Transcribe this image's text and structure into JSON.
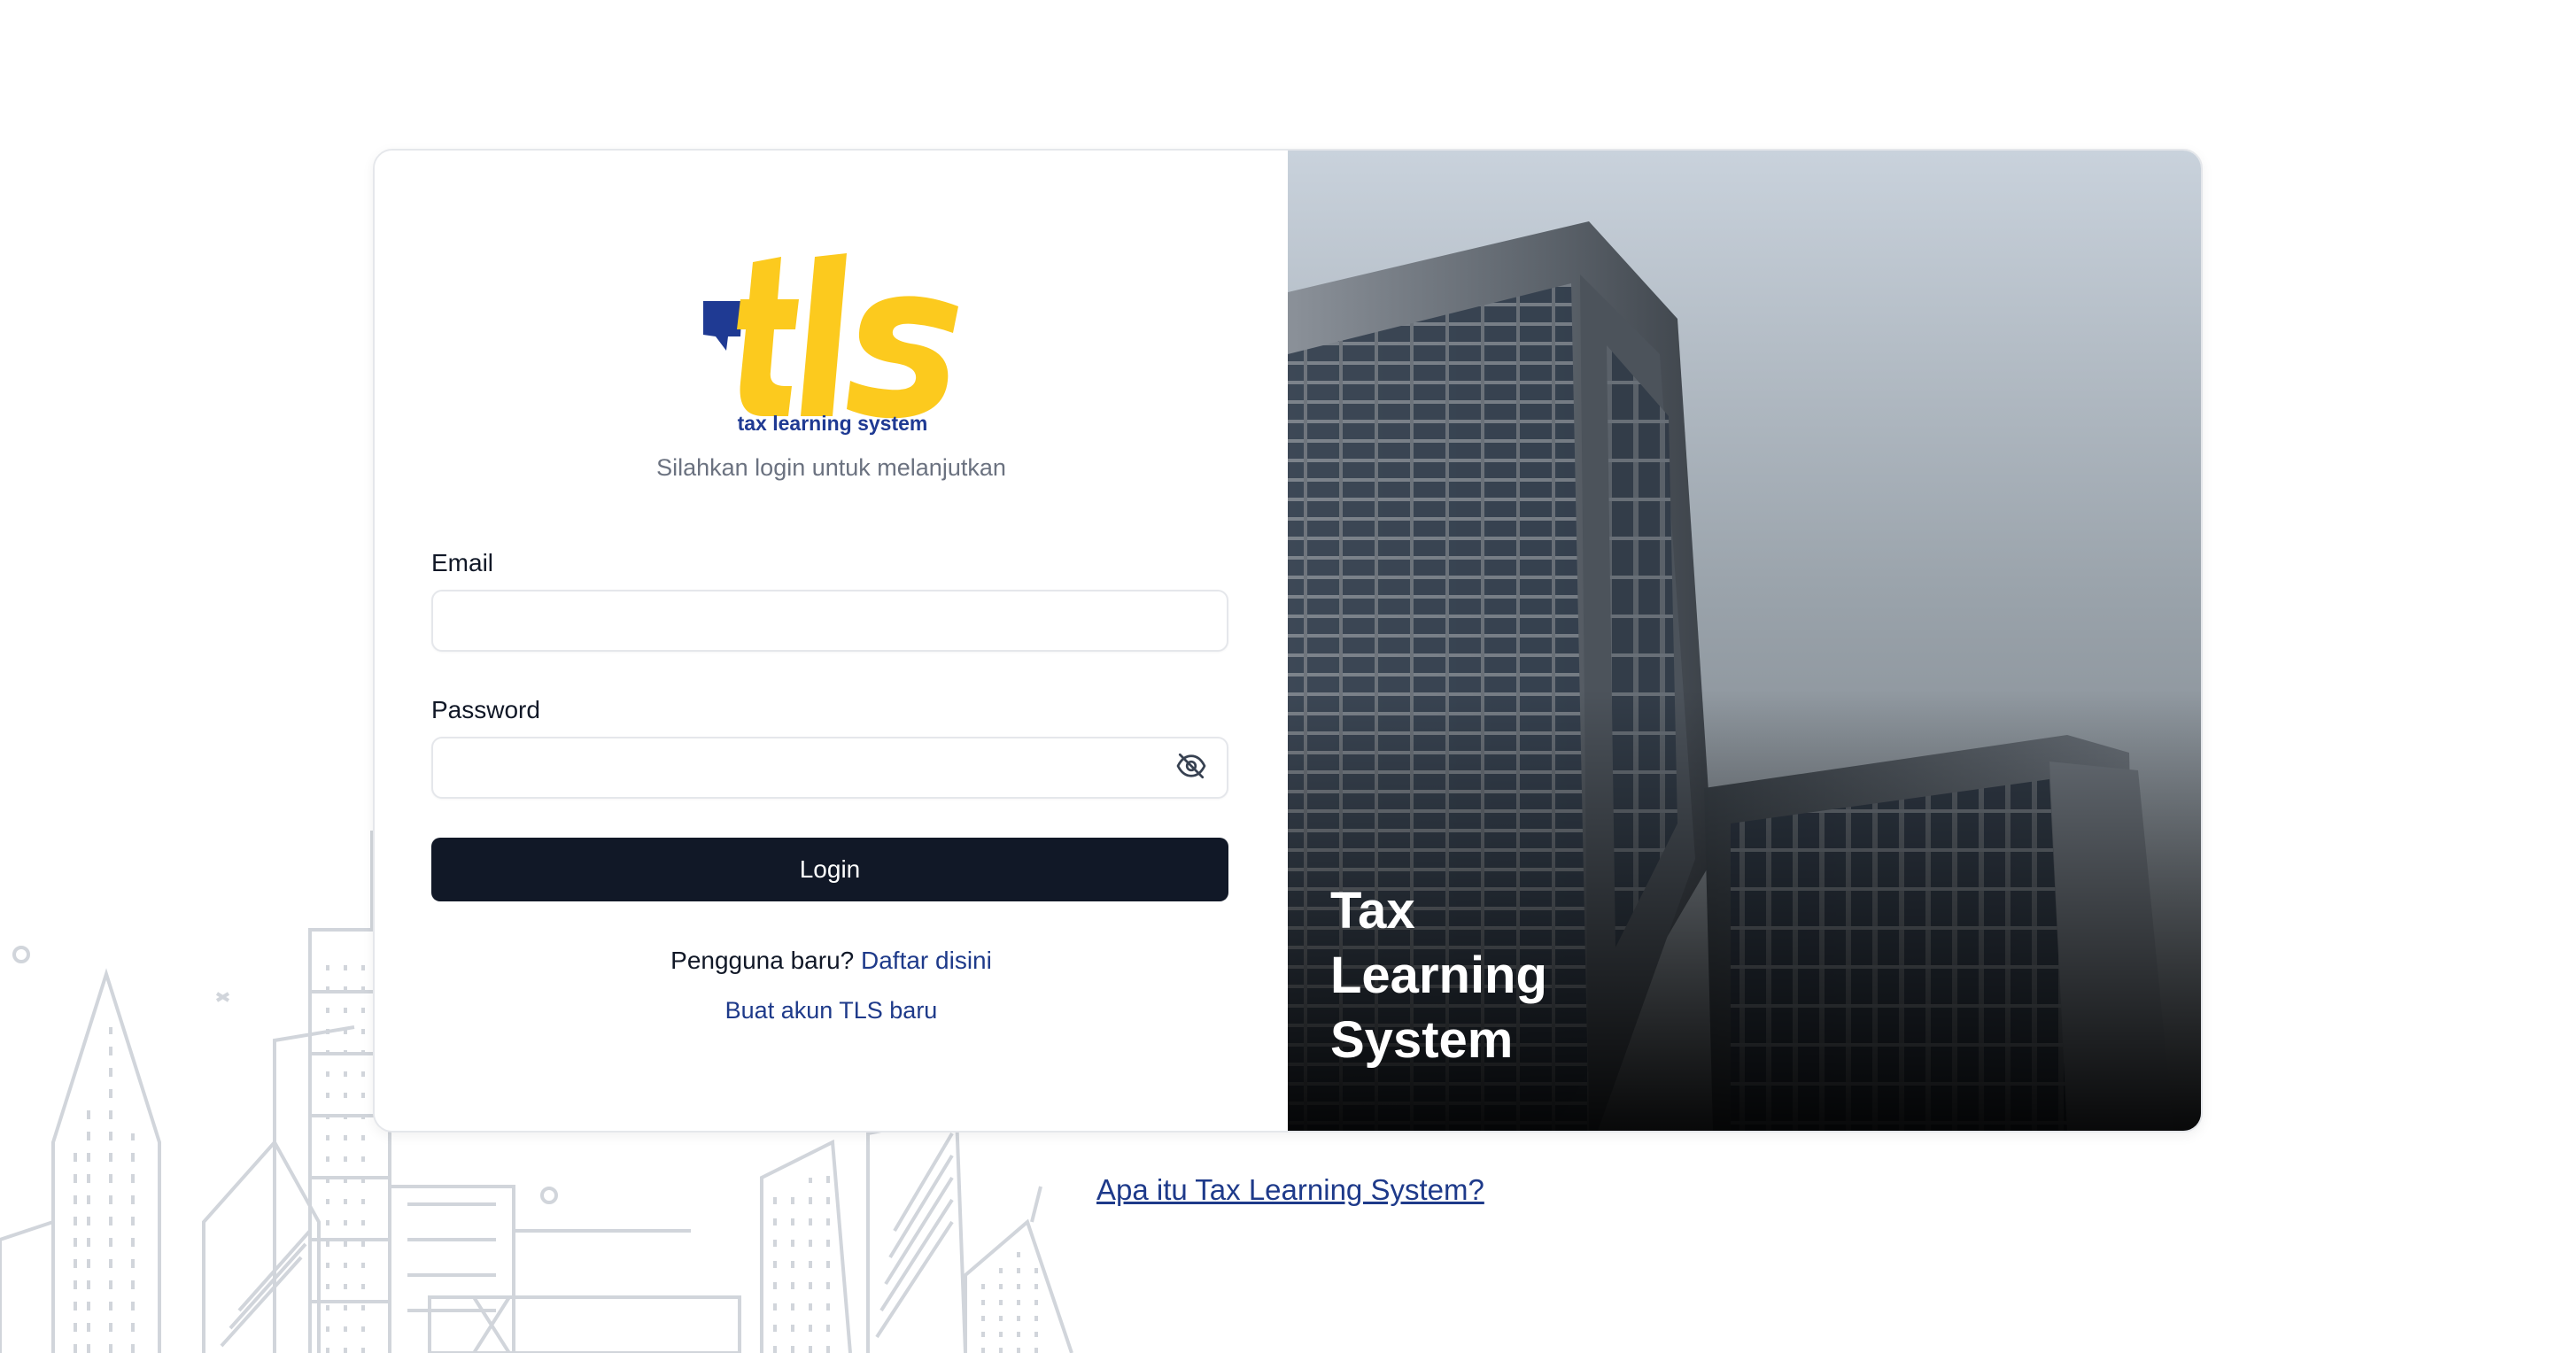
{
  "logo": {
    "mark": "tls",
    "tagline": "tax learning system",
    "primary_color": "#fcca1e",
    "accent_color": "#1f3a93"
  },
  "login": {
    "subtitle": "Silahkan login untuk melanjutkan",
    "email_label": "Email",
    "email_value": "",
    "password_label": "Password",
    "password_value": "",
    "password_toggle_icon": "eye-off-icon",
    "login_button": "Login",
    "new_user_text": "Pengguna baru?",
    "register_link": "Daftar disini",
    "create_account_link": "Buat akun TLS baru"
  },
  "hero": {
    "title": "Tax\nLearning\nSystem",
    "image": "building-photo"
  },
  "footer": {
    "about_link": "Apa itu Tax Learning System?"
  },
  "colors": {
    "button_bg": "#111827",
    "link": "#1e3a8a",
    "muted_text": "#6b7280",
    "border": "#e5e7eb"
  }
}
